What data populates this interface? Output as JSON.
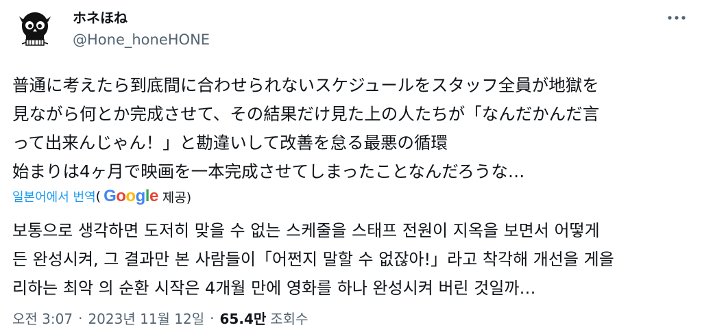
{
  "author": {
    "name": "ホネほね",
    "handle": "@Hone_honeHONE"
  },
  "more_icon": "more-horizontal-icon",
  "original_text_lines": [
    "普通に考えたら到底間に合わせられないスケジュールをスタッフ全員が地獄を",
    "見ながら何とか完成させて、その結果だけ見た上の人たちが「なんだかんだ言",
    "って出来んじゃん！」と勘違いして改善を怠る最悪の循環",
    "始まりは4ヶ月で映画を一本完成させてしまったことなんだろうな…"
  ],
  "translation": {
    "link_label": "일본어에서 번역",
    "paren_open": "(",
    "google_logo": {
      "letters": [
        "G",
        "o",
        "o",
        "g",
        "l",
        "e"
      ],
      "colors": [
        "#4285F4",
        "#EA4335",
        "#FBBC05",
        "#4285F4",
        "#34A853",
        "#EA4335"
      ]
    },
    "provider_suffix": "제공)",
    "text_lines": [
      "보통으로 생각하면 도저히 맞을 수 없는 스케줄을 스태프 전원이 지옥을 보면서 어떻게",
      "든 완성시켜, 그 결과만 본 사람들이「어쩐지 말할 수 없잖아!」라고 착각해 개선을 게을",
      "리하는 최악 의 순환 시작은 4개월 만에 영화를 하나 완성시켜 버린 것일까…"
    ]
  },
  "meta": {
    "time": "오전 3:07",
    "separator": "·",
    "date": "2023년 11월 12일",
    "views_count": "65.4만",
    "views_label": "조회수"
  }
}
